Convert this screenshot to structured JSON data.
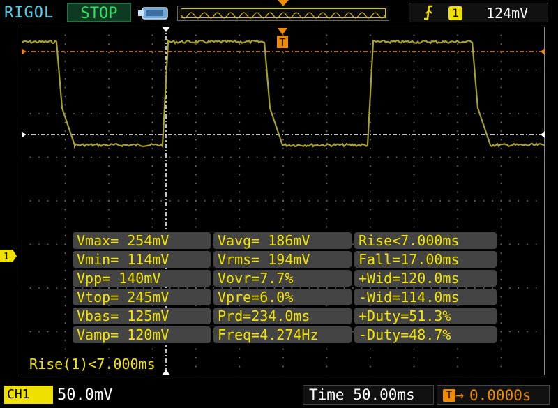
{
  "header": {
    "brand": "RIGOL",
    "run_state": "STOP",
    "trigger": {
      "source_channel": "1",
      "level": "124mV",
      "edge": "rising"
    }
  },
  "channel_marker": "1",
  "trigger_marker": "T",
  "measurements": {
    "rows": [
      [
        "Vmax= 254mV",
        "Vavg= 186mV",
        "Rise<7.000ms"
      ],
      [
        "Vmin= 114mV",
        "Vrms= 194mV",
        "Fall=17.00ms"
      ],
      [
        "Vpp= 140mV",
        "Vovr=7.7%",
        "+Wid=120.0ms"
      ],
      [
        "Vtop= 245mV",
        "Vpre=6.0%",
        "-Wid=114.0ms"
      ],
      [
        "Vbas= 125mV",
        "Prd=234.0ms",
        "+Duty=51.3%"
      ],
      [
        "Vamp= 120mV",
        "Freq=4.274Hz",
        "-Duty=48.7%"
      ]
    ],
    "active_readout": "Rise(1)<7.000ms"
  },
  "footer": {
    "channel_label": "CH1",
    "channel_scale": "50.0mV",
    "timebase": "Time 50.00ms",
    "trigger_offset_icon": "T",
    "trigger_offset": "0.0000s"
  },
  "colors": {
    "trace": "#a8a028",
    "grid": "#7a7a7a",
    "trigger": "#f08a00",
    "measure_text": "#f2e400",
    "run_state": "#2fe060",
    "brand": "#4fd0e8"
  }
}
